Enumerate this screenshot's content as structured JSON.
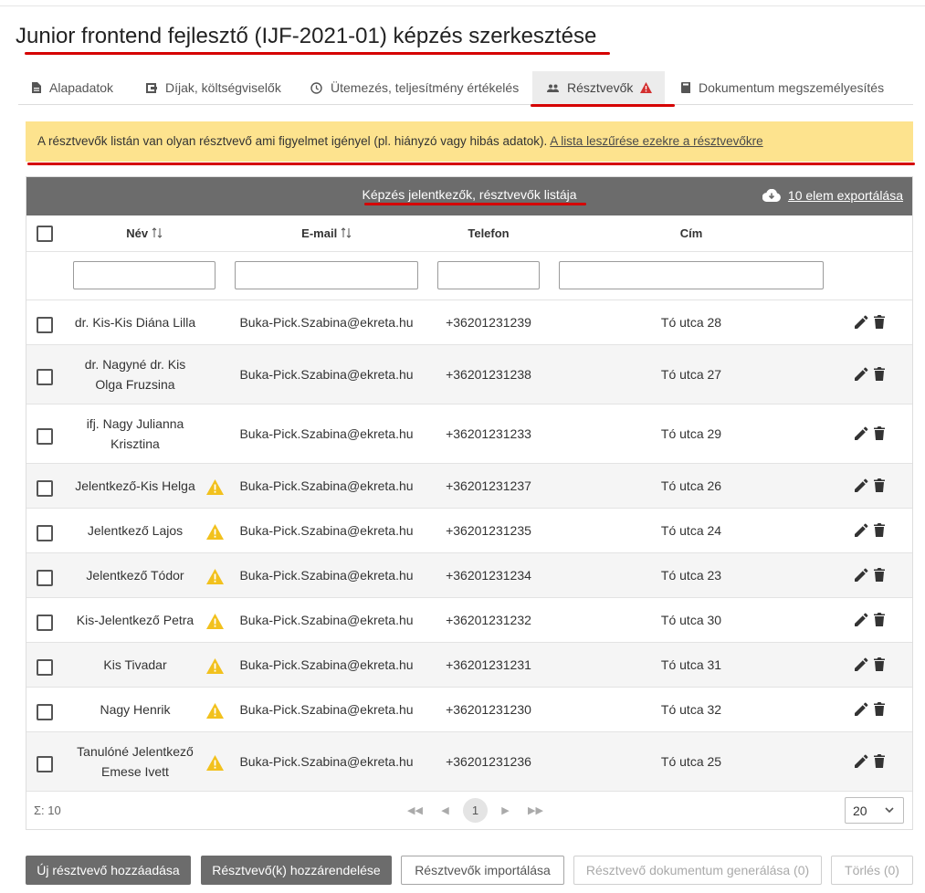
{
  "page": {
    "title": "Junior frontend fejlesztő (IJF-2021-01) képzés szerkesztése"
  },
  "tabs": [
    {
      "label": "Alapadatok",
      "icon": "document-icon"
    },
    {
      "label": "Díjak, költségviselők",
      "icon": "wallet-icon"
    },
    {
      "label": "Ütemezés, teljesítmény értékelés",
      "icon": "clock-icon"
    },
    {
      "label": "Résztvevők",
      "icon": "people-icon",
      "active": true,
      "warning": true
    },
    {
      "label": "Dokumentum megszemélyesítés",
      "icon": "book-icon"
    }
  ],
  "alert": {
    "text": "A résztvevők listán van olyan résztvevő ami figyelmet igényel (pl. hiányzó vagy hibás adatok).",
    "link": "A lista leszűrése ezekre a résztvevőkre"
  },
  "grid": {
    "title": "Képzés jelentkezők, résztvevők listája",
    "export": "10 elem exportálása",
    "columns": {
      "name": "Név",
      "email": "E-mail",
      "phone": "Telefon",
      "address": "Cím"
    },
    "rows": [
      {
        "name": "dr. Kis-Kis Diána Lilla",
        "email": "Buka-Pick.Szabina@ekreta.hu",
        "phone": "+36201231239",
        "address": "Tó utca 28",
        "warning": false
      },
      {
        "name": "dr. Nagyné dr. Kis Olga Fruzsina",
        "email": "Buka-Pick.Szabina@ekreta.hu",
        "phone": "+36201231238",
        "address": "Tó utca 27",
        "warning": false
      },
      {
        "name": "ifj. Nagy Julianna Krisztina",
        "email": "Buka-Pick.Szabina@ekreta.hu",
        "phone": "+36201231233",
        "address": "Tó utca 29",
        "warning": false
      },
      {
        "name": "Jelentkező-Kis Helga",
        "email": "Buka-Pick.Szabina@ekreta.hu",
        "phone": "+36201231237",
        "address": "Tó utca 26",
        "warning": true
      },
      {
        "name": "Jelentkező Lajos",
        "email": "Buka-Pick.Szabina@ekreta.hu",
        "phone": "+36201231235",
        "address": "Tó utca 24",
        "warning": true
      },
      {
        "name": "Jelentkező Tódor",
        "email": "Buka-Pick.Szabina@ekreta.hu",
        "phone": "+36201231234",
        "address": "Tó utca 23",
        "warning": true
      },
      {
        "name": "Kis-Jelentkező Petra",
        "email": "Buka-Pick.Szabina@ekreta.hu",
        "phone": "+36201231232",
        "address": "Tó utca 30",
        "warning": true
      },
      {
        "name": "Kis Tivadar",
        "email": "Buka-Pick.Szabina@ekreta.hu",
        "phone": "+36201231231",
        "address": "Tó utca 31",
        "warning": true
      },
      {
        "name": "Nagy Henrik",
        "email": "Buka-Pick.Szabina@ekreta.hu",
        "phone": "+36201231230",
        "address": "Tó utca 32",
        "warning": true
      },
      {
        "name": "Tanulóné Jelentkező Emese Ivett",
        "email": "Buka-Pick.Szabina@ekreta.hu",
        "phone": "+36201231236",
        "address": "Tó utca 25",
        "warning": true
      }
    ],
    "sum": "Σ: 10",
    "current_page": "1",
    "page_size": "20"
  },
  "buttons": {
    "add_participant": "Új résztvevő hozzáadása",
    "assign_participants": "Résztvevő(k) hozzárendelése",
    "import_participants": "Résztvevők importálása",
    "generate_document": "Résztvevő dokumentum generálása (0)",
    "delete": "Törlés (0)"
  },
  "colors": {
    "accent_red": "#d50000",
    "alert_bg": "#fde38e",
    "header_gray": "#6c6c6c",
    "warning_yellow": "#f2c11d"
  }
}
